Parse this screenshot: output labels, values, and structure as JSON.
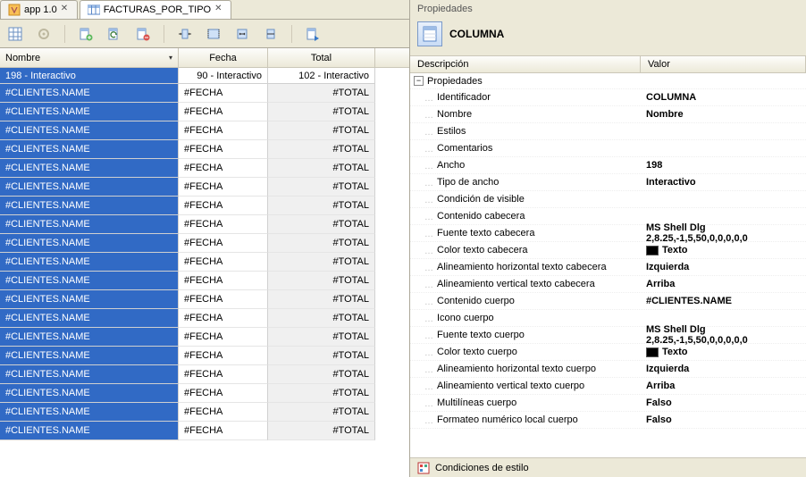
{
  "tabs": [
    {
      "label": "app 1.0"
    },
    {
      "label": "FACTURAS_POR_TIPO"
    }
  ],
  "grid": {
    "headers": {
      "c1": "Nombre",
      "c2": "Fecha",
      "c3": "Total"
    },
    "subheader": {
      "c1": "198 - Interactivo",
      "c2": "90 - Interactivo",
      "c3": "102 - Interactivo"
    },
    "cell_c1": "#CLIENTES.NAME",
    "cell_c2": "#FECHA",
    "cell_c3": "#TOTAL",
    "row_count": 19
  },
  "properties": {
    "pane_title": "Propiedades",
    "object_label": "COLUMNA",
    "col_desc": "Descripción",
    "col_val": "Valor",
    "group": "Propiedades",
    "items": [
      {
        "key": "Identificador",
        "val": "COLUMNA",
        "bold": true
      },
      {
        "key": "Nombre",
        "val": "Nombre",
        "bold": true
      },
      {
        "key": "Estilos",
        "val": ""
      },
      {
        "key": "Comentarios",
        "val": ""
      },
      {
        "key": "Ancho",
        "val": "198",
        "bold": true
      },
      {
        "key": "Tipo de ancho",
        "val": "Interactivo",
        "bold": true
      },
      {
        "key": "Condición de visible",
        "val": ""
      },
      {
        "key": "Contenido cabecera",
        "val": ""
      },
      {
        "key": "Fuente texto cabecera",
        "val": "MS Shell Dlg 2,8.25,-1,5,50,0,0,0,0,0",
        "bold": true
      },
      {
        "key": "Color texto cabecera",
        "val": "Texto",
        "bold": true,
        "swatch": true
      },
      {
        "key": "Alineamiento horizontal texto cabecera",
        "val": "Izquierda",
        "bold": true
      },
      {
        "key": "Alineamiento vertical texto cabecera",
        "val": "Arriba",
        "bold": true
      },
      {
        "key": "Contenido cuerpo",
        "val": "#CLIENTES.NAME",
        "bold": true
      },
      {
        "key": "Icono cuerpo",
        "val": ""
      },
      {
        "key": "Fuente texto cuerpo",
        "val": "MS Shell Dlg 2,8.25,-1,5,50,0,0,0,0,0",
        "bold": true
      },
      {
        "key": "Color texto cuerpo",
        "val": "Texto",
        "bold": true,
        "swatch": true
      },
      {
        "key": "Alineamiento horizontal texto cuerpo",
        "val": "Izquierda",
        "bold": true
      },
      {
        "key": "Alineamiento vertical texto cuerpo",
        "val": "Arriba",
        "bold": true
      },
      {
        "key": "Multilíneas cuerpo",
        "val": "Falso",
        "bold": true
      },
      {
        "key": "Formateo numérico local cuerpo",
        "val": "Falso",
        "bold": true
      }
    ],
    "footer": "Condiciones de estilo"
  }
}
